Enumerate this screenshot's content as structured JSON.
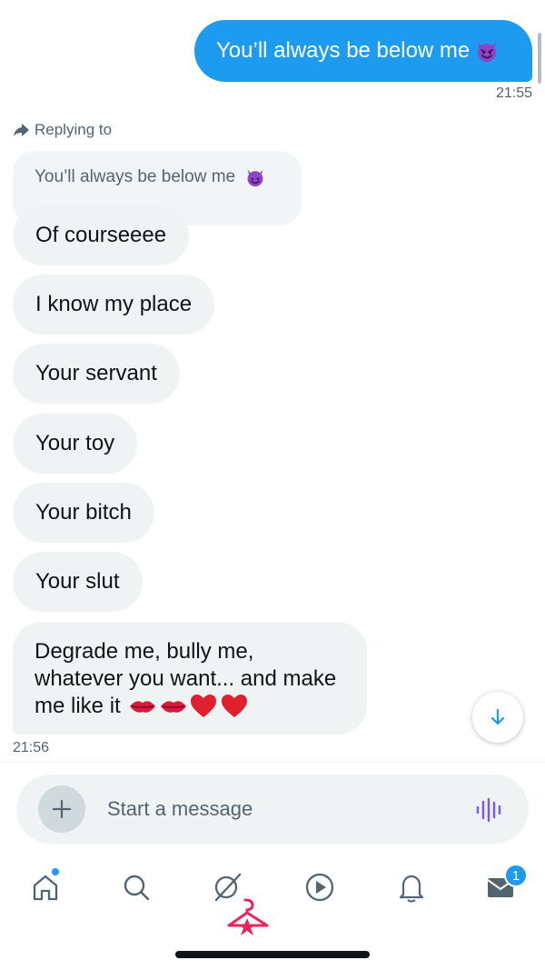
{
  "outgoing": {
    "text": "You’ll always be below me",
    "time": "21:55"
  },
  "reply": {
    "label": "Replying to",
    "quote": "You’ll always be below me"
  },
  "incoming": [
    "Of courseeee",
    "I know my place",
    "Your servant",
    "Your toy",
    "Your bitch",
    "Your slut"
  ],
  "last_message": {
    "line1": "Degrade me,  bully me,",
    "line2": "whatever you want... and make",
    "line3": "me like it",
    "time": "21:56"
  },
  "composer": {
    "placeholder": "Start a message"
  },
  "nav": {
    "messages_badge": "1"
  },
  "colors": {
    "accent": "#1d9bf0",
    "bubble_in": "#eff3f4",
    "muted_text": "#536471",
    "voice": "#7856ff",
    "grok_pink": "#e8265e"
  },
  "icons": [
    "devil-emoji",
    "lips-emoji",
    "heart-emoji",
    "reply-arrow-icon",
    "chevron-down-icon",
    "plus-icon",
    "voice-wave-icon",
    "home-icon",
    "search-icon",
    "grok-icon",
    "play-icon",
    "bell-icon",
    "mail-icon"
  ]
}
